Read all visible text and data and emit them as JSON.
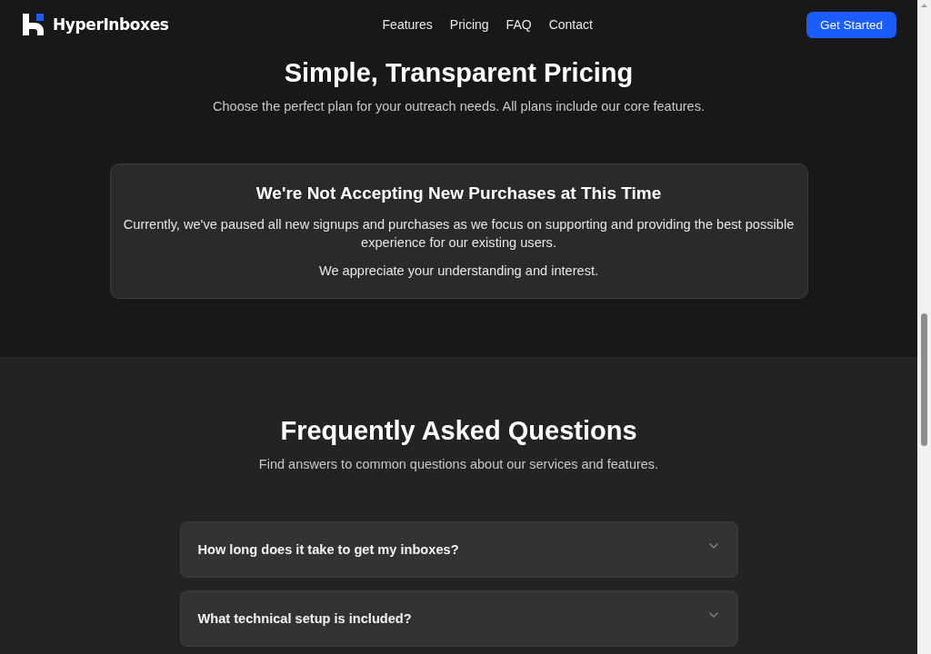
{
  "header": {
    "logo_text": "HyperInboxes",
    "nav_links": [
      "Features",
      "Pricing",
      "FAQ",
      "Contact"
    ],
    "cta_button": "Get Started"
  },
  "pricing": {
    "title": "Simple, Transparent Pricing",
    "subtitle": "Choose the perfect plan for your outreach needs. All plans include our core features.",
    "notice": {
      "title": "We're Not Accepting New Purchases at This Time",
      "paragraphs": [
        "Currently, we've paused all new signups and purchases as we focus on supporting and providing the best possible experience for our existing users.",
        "We appreciate your understanding and interest."
      ]
    }
  },
  "faq": {
    "title": "Frequently Asked Questions",
    "subtitle": "Find answers to common questions about our services and features.",
    "items": [
      {
        "question": "How long does it take to get my inboxes?",
        "expanded": false
      },
      {
        "question": "What technical setup is included?",
        "expanded": false
      }
    ]
  }
}
